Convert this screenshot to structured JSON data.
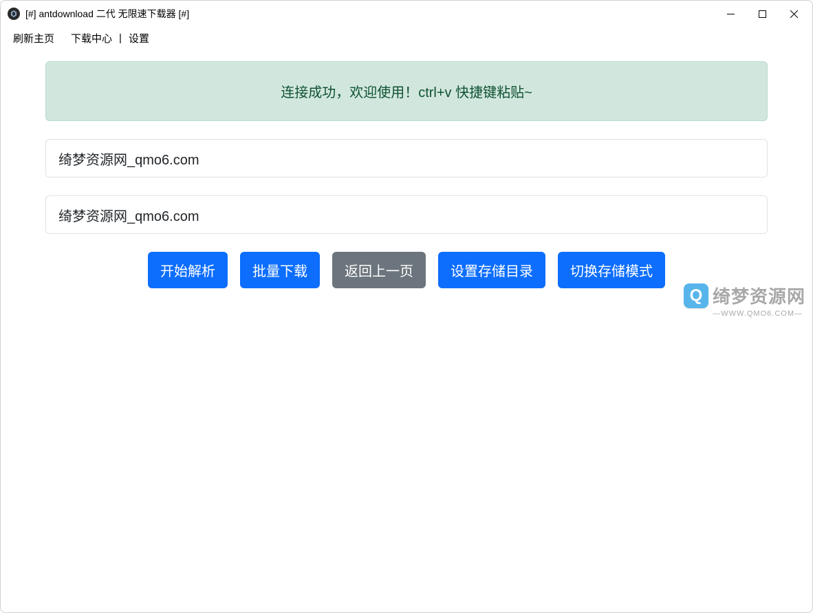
{
  "window": {
    "title": "[#] antdownload 二代 无限速下载器 [#]"
  },
  "menubar": {
    "refresh": "刷新主页",
    "download_center": "下载中心",
    "separator": "|",
    "settings": "设置"
  },
  "alert": {
    "message": "连接成功，欢迎使用！ctrl+v 快捷键粘贴~"
  },
  "inputs": {
    "field1": "绮梦资源网_qmo6.com",
    "field2": "绮梦资源网_qmo6.com"
  },
  "buttons": {
    "start_parse": "开始解析",
    "batch_download": "批量下载",
    "go_back": "返回上一页",
    "set_storage_dir": "设置存储目录",
    "switch_storage_mode": "切换存储模式"
  },
  "watermark": {
    "logo_letter": "Q",
    "text": "绮梦资源网",
    "sub": "—WWW.QMO6.COM—"
  }
}
